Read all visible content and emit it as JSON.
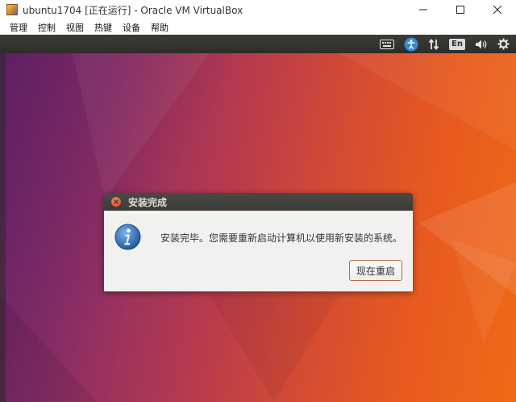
{
  "window": {
    "title": "ubuntu1704 [正在运行] - Oracle VM VirtualBox",
    "icon": "virtualbox-icon",
    "controls": [
      "minimize-icon",
      "maximize-icon",
      "close-icon"
    ]
  },
  "menubar": {
    "items": [
      {
        "label": "管理"
      },
      {
        "label": "控制"
      },
      {
        "label": "视图"
      },
      {
        "label": "热键"
      },
      {
        "label": "设备"
      },
      {
        "label": "帮助"
      }
    ]
  },
  "guest_panel": {
    "language": "En",
    "icons": [
      "keyboard-icon",
      "accessibility-icon",
      "network-icon",
      "language-indicator",
      "volume-icon",
      "settings-gear-icon"
    ]
  },
  "dialog": {
    "title": "安装完成",
    "message": "安装完毕。您需要重新启动计算机以使用新安装的系统。",
    "button_label": "现在重启",
    "icon": "info-icon"
  },
  "colors": {
    "panel": "#3c3b37",
    "close_accent": "#e2431a",
    "info_blue": "#2f6fb5",
    "desktop_purple": "#6e2a6e",
    "desktop_orange": "#ef6a17"
  }
}
